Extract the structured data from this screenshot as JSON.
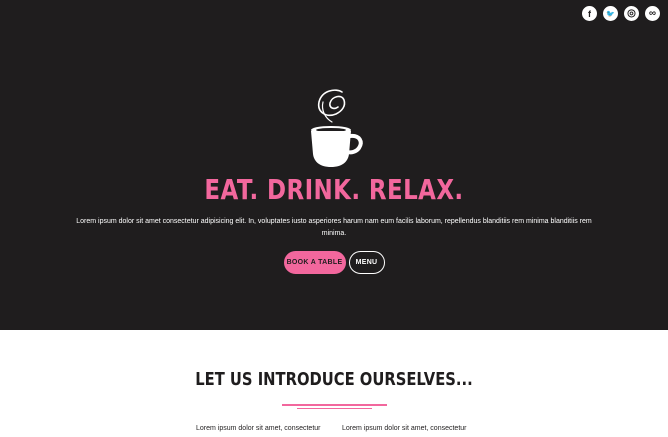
{
  "social": {
    "icons": [
      {
        "name": "facebook-icon",
        "glyph": "f"
      },
      {
        "name": "twitter-icon",
        "glyph": "🐦"
      },
      {
        "name": "instagram-icon",
        "glyph": "◎"
      },
      {
        "name": "tripadvisor-icon",
        "glyph": "∞"
      }
    ]
  },
  "hero": {
    "headline": "EAT. DRINK. RELAX.",
    "lead": "Lorem ipsum dolor sit amet consectetur adipisicing elit. In, voluptates iusto asperiores harum nam eum facilis laborum, repellendus blanditiis rem minima blanditiis rem minima.",
    "book_label": "BOOK A TABLE",
    "menu_label": "MENU"
  },
  "intro": {
    "title": "LET US INTRODUCE OURSELVES...",
    "col1": "Lorem ipsum dolor sit amet, consectetur",
    "col2": "Lorem ipsum dolor sit amet, consectetur"
  },
  "colors": {
    "background_dark": "#1f1d1e",
    "accent_pink": "#f2679d",
    "white": "#ffffff"
  }
}
